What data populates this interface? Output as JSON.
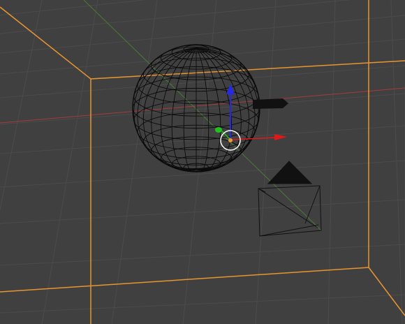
{
  "viewport": {
    "name": "3D Viewport",
    "background": "#404040",
    "grid_color": "#4b4b4b",
    "selection_color": "#e8952f",
    "x_axis_color": "#a63b3b",
    "y_axis_color": "#4c7a36"
  },
  "objects": [
    {
      "name": "sphere",
      "display": "wireframe",
      "color": "#000000"
    },
    {
      "name": "camera",
      "display": "wireframe",
      "color": "#000000"
    },
    {
      "name": "lamp",
      "display": "solid",
      "color": "#000000"
    }
  ],
  "gizmo": {
    "x_color": "#e01818",
    "y_color": "#21c021",
    "z_color": "#2828e8",
    "origin_color": "#e59a3c",
    "ring_color": "#ffffff"
  },
  "icons": [
    "translate-gizmo-icon",
    "camera-icon",
    "lamp-icon",
    "sphere-icon"
  ]
}
